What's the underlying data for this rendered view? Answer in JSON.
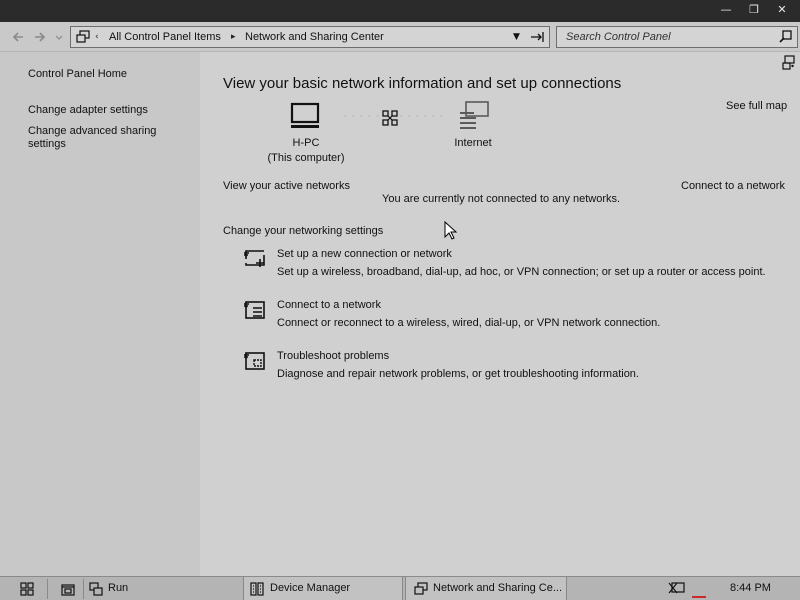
{
  "window": {
    "minimize_glyph": "—",
    "restore_glyph": "❐",
    "close_glyph": "✕"
  },
  "navigation": {
    "back_icon": "back-arrow-icon",
    "forward_icon": "forward-arrow-icon",
    "recent_icon": "recent-pages-chevron-icon"
  },
  "address_bar": {
    "breadcrumb": [
      "All Control Panel Items",
      "Network and Sharing Center"
    ],
    "separator": "▸",
    "overflow": "‹"
  },
  "search": {
    "placeholder": "Search Control Panel"
  },
  "left_pane": {
    "home_link": "Control Panel Home",
    "links": [
      "Change adapter settings",
      "Change advanced sharing settings"
    ]
  },
  "main": {
    "title": "View your basic network information and set up connections",
    "see_full_map": "See full map",
    "computer": {
      "name": "H-PC",
      "caption": "(This computer)"
    },
    "internet_label": "Internet",
    "active_networks_label": "View your active networks",
    "connect_link": "Connect to a network",
    "not_connected_text": "You are currently not connected to any networks.",
    "settings_heading": "Change your networking settings",
    "tasks": [
      {
        "title": "Set up a new connection or network",
        "description": "Set up a wireless, broadband, dial-up, ad hoc, or VPN connection; or set up a router or access point.",
        "icon": "new-connection-icon"
      },
      {
        "title": "Connect to a network",
        "description": "Connect or reconnect to a wireless, wired, dial-up, or VPN network connection.",
        "icon": "connect-network-icon"
      },
      {
        "title": "Troubleshoot problems",
        "description": "Diagnose and repair network problems, or get troubleshooting information.",
        "icon": "troubleshoot-icon"
      }
    ]
  },
  "taskbar": {
    "run_label": "Run",
    "items": [
      "Device Manager",
      "Network and Sharing Ce..."
    ],
    "clock": "8:44 PM"
  },
  "colors": {
    "title_bar": "#2b2b2b",
    "left_pane": "#c8c8c8",
    "main_pane": "#d0d0d0",
    "taskbar": "#b4b4b4",
    "network_tray_alert": "#cc2a2a"
  }
}
